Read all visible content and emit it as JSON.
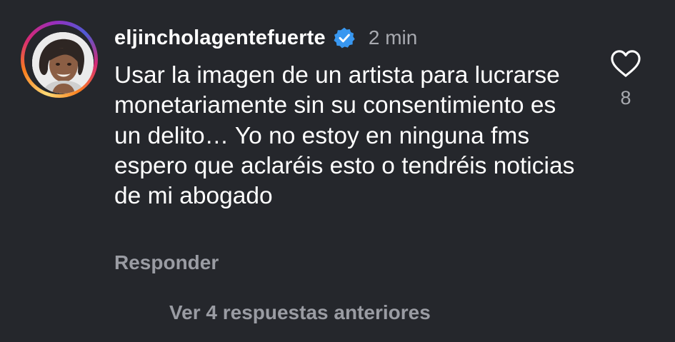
{
  "comment": {
    "username": "eljincholagentefuerte",
    "verified_icon": "verified-badge-icon",
    "time": "2 min",
    "text": "Usar la imagen de un artista para lucrarse monetariamente sin su consentimiento es un delito… Yo no estoy en ninguna fms espero que aclaréis esto o tendréis noticias de mi abogado",
    "reply_label": "Responder",
    "like_icon": "heart-outline-icon",
    "like_count": "8"
  },
  "replies": {
    "view_label": "Ver 4 respuestas anteriores"
  },
  "colors": {
    "background": "#25272c",
    "verified_blue": "#3897f0",
    "secondary_text": "#9a9ca3"
  }
}
